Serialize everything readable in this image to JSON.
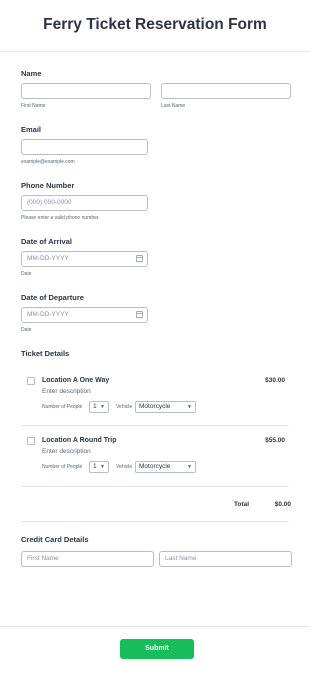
{
  "form": {
    "title": "Ferry Ticket Reservation Form"
  },
  "name": {
    "label": "Name",
    "first_sublabel": "First Name",
    "last_sublabel": "Last Name"
  },
  "email": {
    "label": "Email",
    "sublabel": "example@example.com"
  },
  "phone": {
    "label": "Phone Number",
    "placeholder": "(000) 000-0000",
    "sublabel": "Please enter a valid phone number."
  },
  "arrival": {
    "label": "Date of Arrival",
    "placeholder": "MM-DD-YYYY",
    "sublabel": "Date"
  },
  "departure": {
    "label": "Date of Departure",
    "placeholder": "MM-DD-YYYY",
    "sublabel": "Date"
  },
  "tickets": {
    "label": "Ticket Details",
    "items": [
      {
        "name": "Location A One Way",
        "description": "Enter description",
        "price": "$30.00",
        "people_label": "Number of People",
        "people_value": "1",
        "vehicle_label": "Vehicle",
        "vehicle_value": "Motorcycle"
      },
      {
        "name": "Location A Round Trip",
        "description": "Enter description",
        "price": "$55.00",
        "people_label": "Number of People",
        "people_value": "1",
        "vehicle_label": "Vehicle",
        "vehicle_value": "Motorcycle"
      }
    ],
    "total_label": "Total",
    "total_value": "$0.00"
  },
  "credit_card": {
    "label": "Credit Card Details",
    "first_placeholder": "First Name",
    "last_placeholder": "Last Name"
  },
  "submit": {
    "label": "Submit"
  },
  "icons": {
    "calendar": "calendar-icon",
    "chevron": "chevron-down-icon"
  },
  "colors": {
    "accent": "#18bd5b",
    "text": "#2c3345",
    "border": "#b8bdc9"
  }
}
